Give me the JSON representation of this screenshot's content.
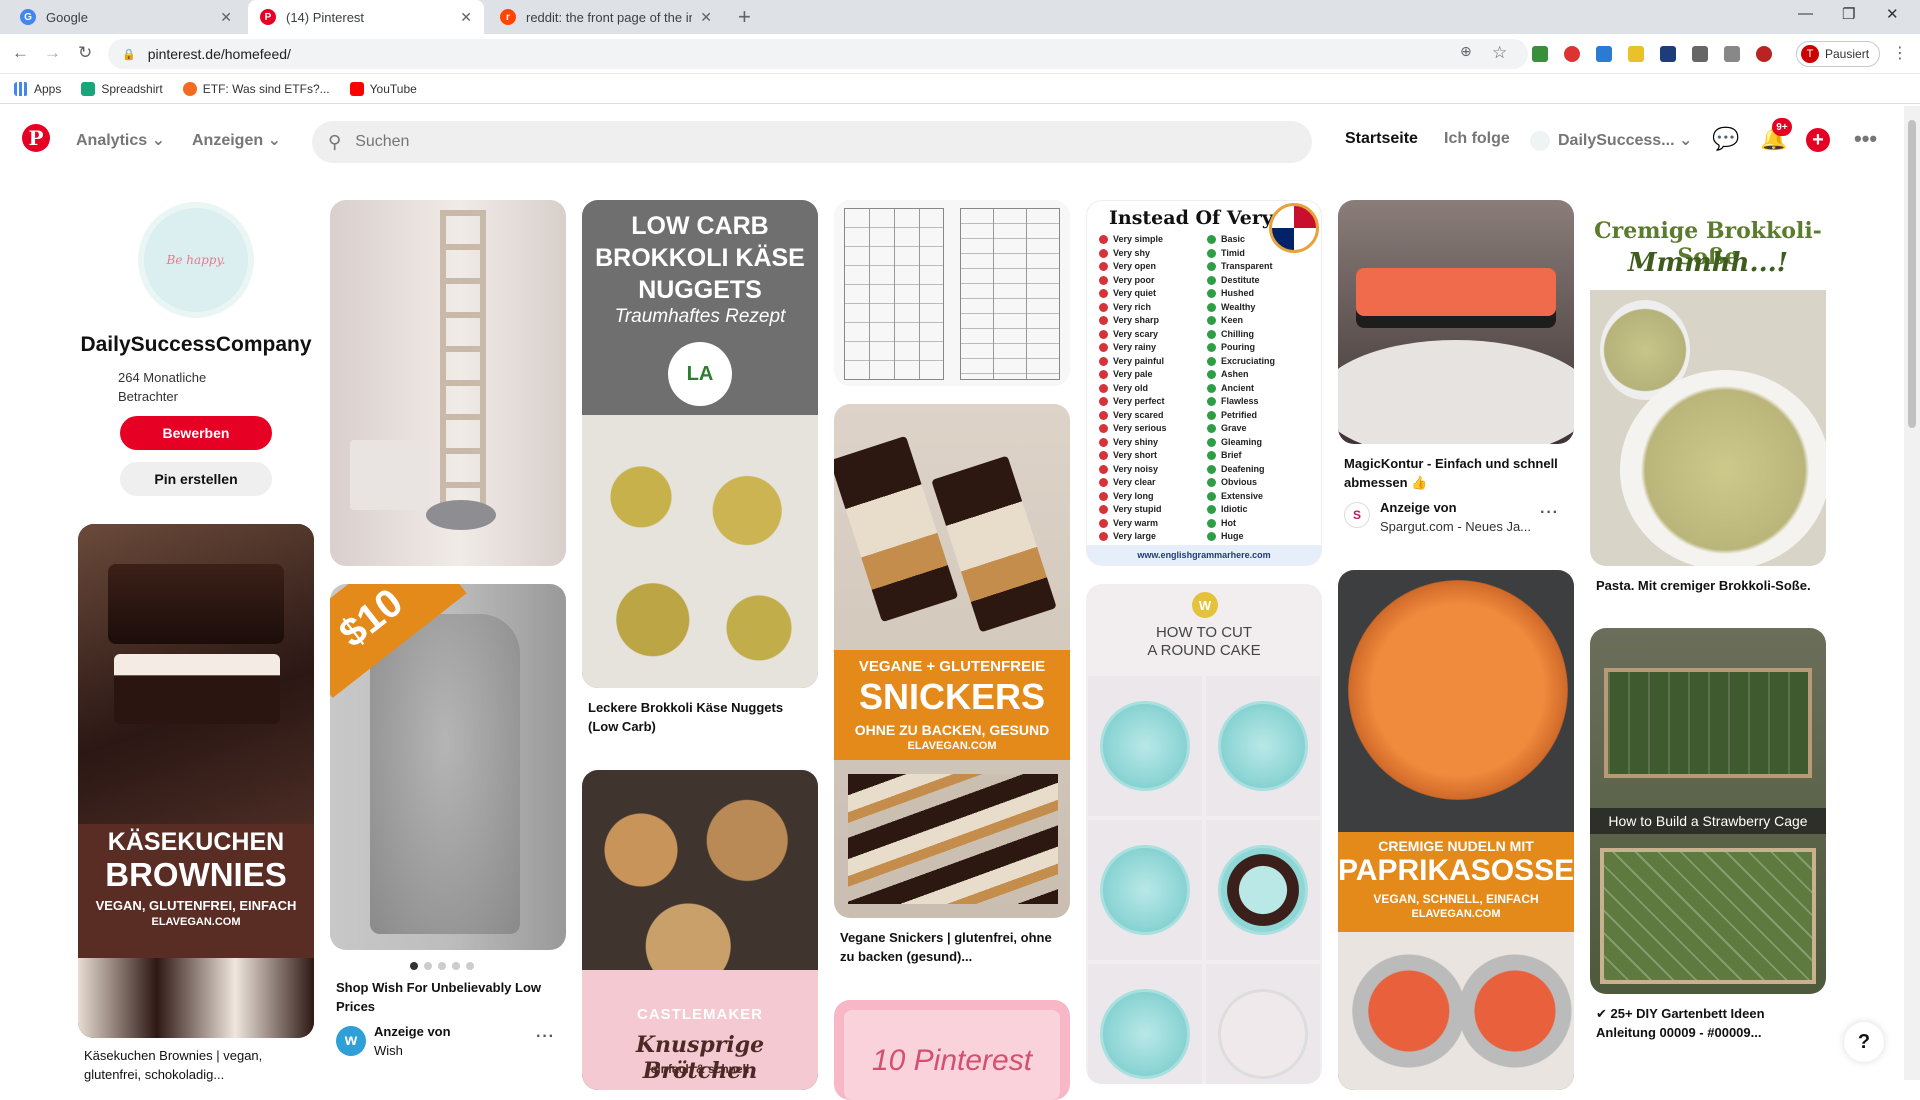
{
  "browser": {
    "tabs": [
      {
        "title": "Google"
      },
      {
        "title": "(14) Pinterest"
      },
      {
        "title": "reddit: the front page of the inte"
      }
    ],
    "url": "pinterest.de/homefeed/",
    "bookmarks": [
      {
        "label": "Apps"
      },
      {
        "label": "Spreadshirt"
      },
      {
        "label": "ETF: Was sind ETFs?..."
      },
      {
        "label": "YouTube"
      }
    ],
    "profile_label": "Pausiert",
    "profile_initial": "T"
  },
  "header": {
    "logo": "P",
    "menu": [
      {
        "label": "Analytics"
      },
      {
        "label": "Anzeigen"
      }
    ],
    "search_placeholder": "Suchen",
    "links": [
      {
        "label": "Startseite"
      },
      {
        "label": "Ich folge"
      }
    ],
    "account": "DailySuccess...",
    "notif_badge": "9+"
  },
  "profile": {
    "avatar_text": "Be happy.",
    "name": "DailySuccessCompany",
    "views": "264 Monatliche Betrachter",
    "edit_button": "Bewerben",
    "create_button": "Pin erstellen"
  },
  "pins": {
    "brownies": {
      "line1": "KÄSEKUCHEN",
      "line2": "BROWNIES",
      "line3": "VEGAN, GLUTENFREI, EINFACH",
      "line4": "ELAVEGAN.COM",
      "title": "Käsekuchen Brownies | vegan, glutenfrei, schokoladig..."
    },
    "jacket": {
      "price": "$10",
      "title": "Shop Wish For Unbelievably Low Prices",
      "ad": "Anzeige von",
      "advertiser": "Wish"
    },
    "brokkoli": {
      "line1": "LOW CARB",
      "line2": "BROKKOLI KÄSE",
      "line3": "NUGGETS",
      "line4": "Traumhaftes Rezept",
      "logo": "LA",
      "title": "Leckere Brokkoli Käse Nuggets (Low Carb)"
    },
    "broetchen": {
      "brand": "CASTLEMAKER",
      "line1": "Knusprige Brötchen",
      "line2": "einfach & schnell"
    },
    "snickers": {
      "line1": "VEGANE + GLUTENFREIE",
      "line2": "SNICKERS",
      "line3": "OHNE ZU BACKEN, GESUND",
      "line4": "ELAVEGAN.COM",
      "title": "Vegane Snickers | glutenfrei, ohne zu backen (gesund)..."
    },
    "pinterest10": {
      "line1": "10 Pinterest"
    },
    "very": {
      "heading": "Instead Of Very",
      "very": [
        "Very simple",
        "Very shy",
        "Very open",
        "Very poor",
        "Very quiet",
        "Very rich",
        "Very sharp",
        "Very scary",
        "Very rainy",
        "Very painful",
        "Very pale",
        "Very old",
        "Very perfect",
        "Very scared",
        "Very serious",
        "Very shiny",
        "Very short",
        "Very noisy",
        "Very clear",
        "Very long",
        "Very stupid",
        "Very warm",
        "Very large"
      ],
      "words": [
        "Basic",
        "Timid",
        "Transparent",
        "Destitute",
        "Hushed",
        "Wealthy",
        "Keen",
        "Chilling",
        "Pouring",
        "Excruciating",
        "Ashen",
        "Ancient",
        "Flawless",
        "Petrified",
        "Grave",
        "Gleaming",
        "Brief",
        "Deafening",
        "Obvious",
        "Extensive",
        "Idiotic",
        "Hot",
        "Huge"
      ],
      "footer": "www.englishgrammarhere.com"
    },
    "cake": {
      "line1": "HOW TO CUT",
      "line2": "A ROUND CAKE"
    },
    "magic": {
      "title": "MagicKontur - Einfach und schnell abmessen 👍",
      "ad": "Anzeige von",
      "advertiser": "Spargut.com - Neues Ja..."
    },
    "nudeln": {
      "line1": "CREMIGE NUDELN MIT",
      "line2": "PAPRIKASOSSE",
      "line3": "VEGAN, SCHNELL, EINFACH",
      "line4": "ELAVEGAN.COM"
    },
    "pasta": {
      "line1": "Cremige Brokkoli-Soße",
      "line2": "Mmmhh...!",
      "title": "Pasta. Mit cremiger Brokkoli-Soße."
    },
    "garden": {
      "caption": "How to Build a Strawberry Cage",
      "title": "✔ 25+ DIY Gartenbett Ideen Anleitung 00009 - #00009..."
    }
  },
  "colors": {
    "brand": "#e60023",
    "orange": "#e38a1a",
    "brown": "#5a2d24"
  }
}
